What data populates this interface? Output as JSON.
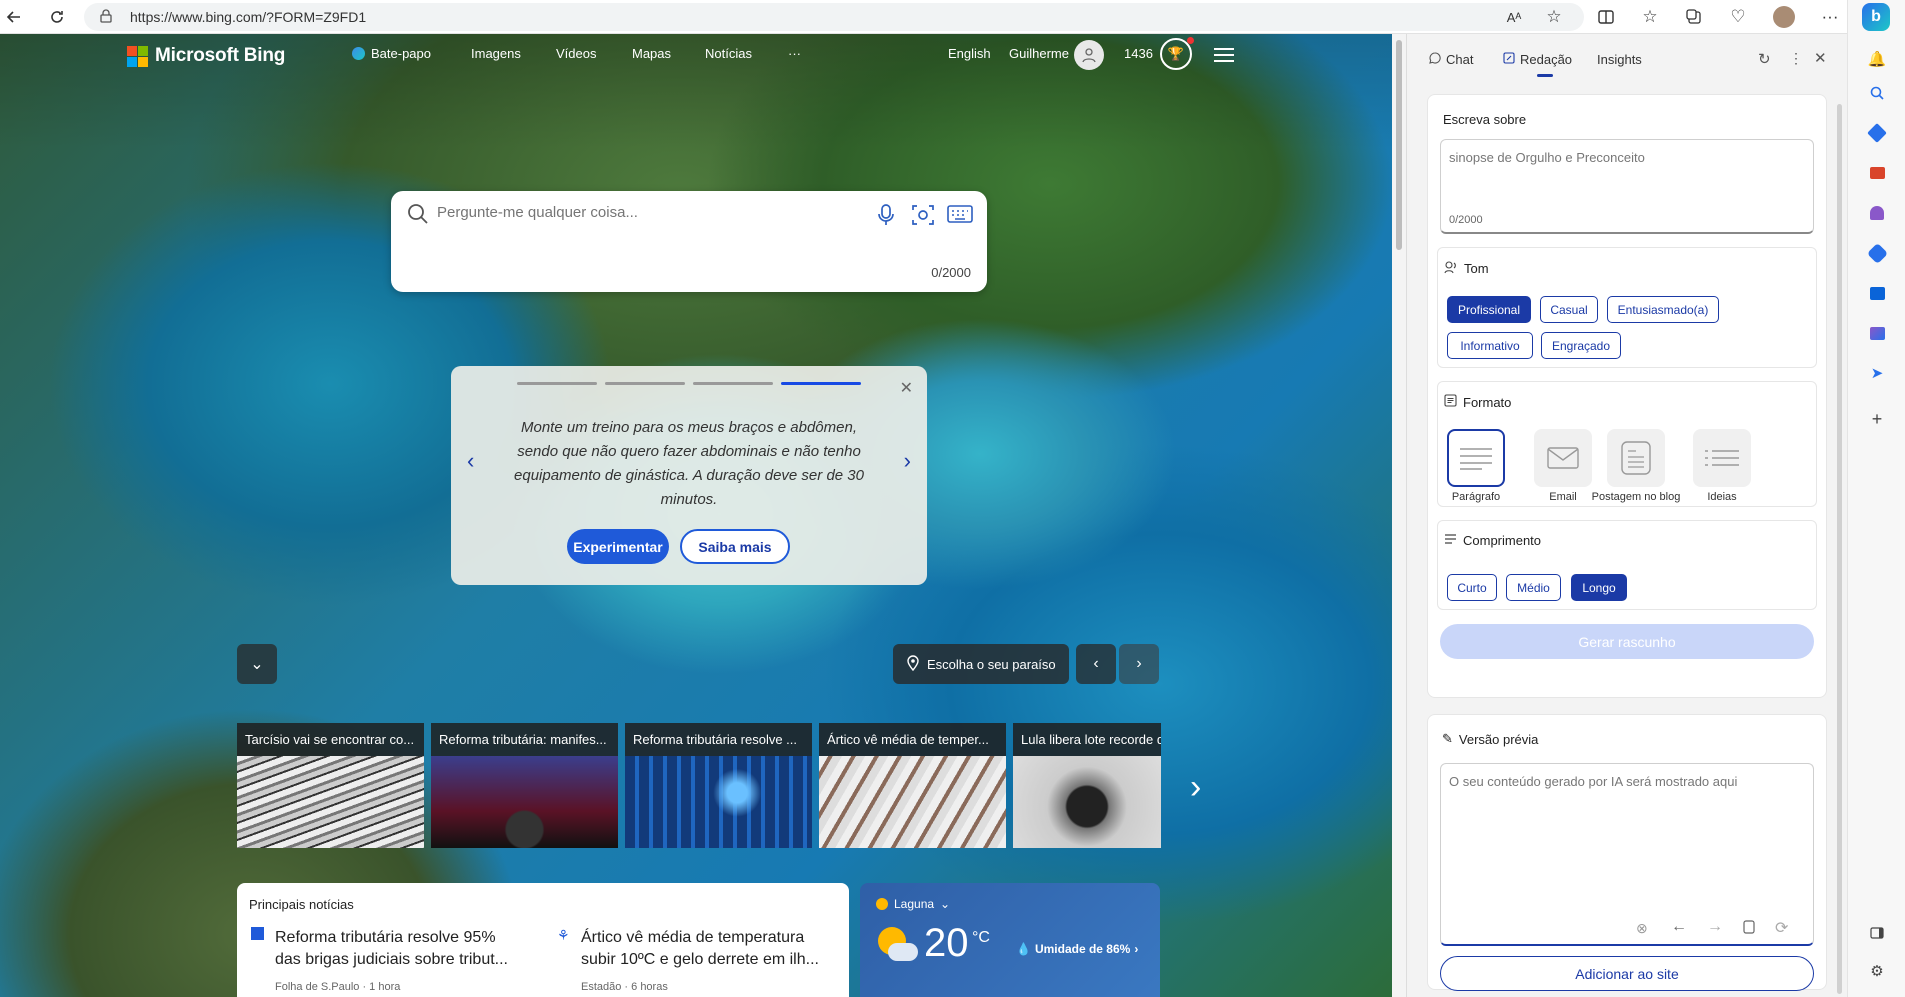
{
  "browser": {
    "url": "https://www.bing.com/?FORM=Z9FD1",
    "reader_label": "Aᴬ"
  },
  "header": {
    "brand": "Microsoft Bing",
    "nav": [
      "Bate-papo",
      "Imagens",
      "Vídeos",
      "Mapas",
      "Notícias",
      "···"
    ],
    "language": "English",
    "user_name": "Guilherme",
    "points": "1436"
  },
  "search": {
    "placeholder": "Pergunte-me qualquer coisa...",
    "counter": "0/2000"
  },
  "promo": {
    "message": "Monte um treino para os meus braços e abdômen, sendo que não quero fazer abdominais e não tenho equipamento de ginástica. A duração deve ser de 30 minutos.",
    "try_label": "Experimentar",
    "learn_label": "Saiba mais"
  },
  "location_button": "Escolha o seu paraíso",
  "news_cards": [
    {
      "title": "Tarcísio vai se encontrar co..."
    },
    {
      "title": "Reforma tributária: manifes..."
    },
    {
      "title": "Reforma tributária resolve ..."
    },
    {
      "title": "Ártico vê média de temper..."
    },
    {
      "title": "Lula libera lote recorde d"
    }
  ],
  "top_news": {
    "heading": "Principais notícias",
    "items": [
      {
        "title": "Reforma tributária resolve 95% das brigas judiciais sobre tribut...",
        "source": "Folha de S.Paulo · 1 hora"
      },
      {
        "title": "Ártico vê média de temperatura subir 10ºC e gelo derrete em ilh...",
        "source": "Estadão · 6 horas"
      }
    ]
  },
  "weather": {
    "location": "Laguna",
    "temp": "20",
    "unit": "°C",
    "humidity": "Umidade de 86%"
  },
  "panel": {
    "tabs": [
      "Chat",
      "Redação",
      "Insights"
    ],
    "active_tab": "Redação",
    "write_about_label": "Escreva sobre",
    "write_placeholder": "sinopse de Orgulho e Preconceito",
    "write_counter": "0/2000",
    "tone_label": "Tom",
    "tones": [
      "Profissional",
      "Casual",
      "Entusiasmado(a)",
      "Informativo",
      "Engraçado"
    ],
    "tone_selected": "Profissional",
    "format_label": "Formato",
    "formats": [
      "Parágrafo",
      "Email",
      "Postagem no blog",
      "Ideias"
    ],
    "format_selected": "Parágrafo",
    "length_label": "Comprimento",
    "lengths": [
      "Curto",
      "Médio",
      "Longo"
    ],
    "length_selected": "Longo",
    "generate_label": "Gerar rascunho",
    "preview_label": "Versão prévia",
    "preview_placeholder": "O seu conteúdo gerado por IA será mostrado aqui",
    "add_to_site_label": "Adicionar ao site"
  },
  "colors": {
    "accent": "#1b3aa6",
    "promo_blue": "#174ae4",
    "bing_blue": "#2870ea"
  }
}
